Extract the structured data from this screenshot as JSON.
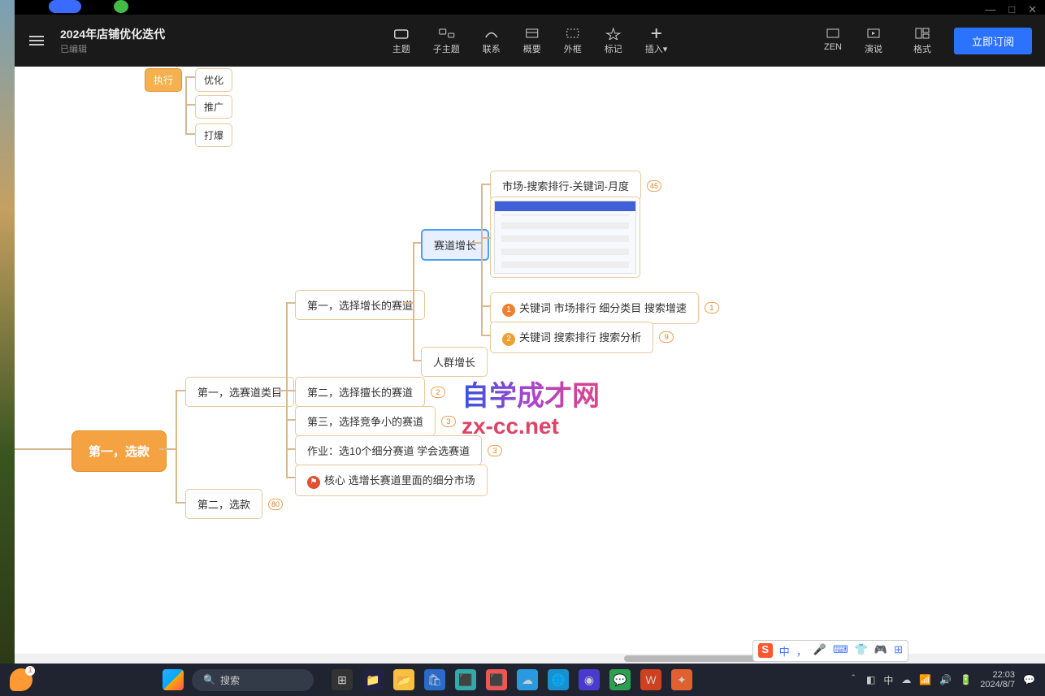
{
  "app": {
    "title": "2024年店铺优化迭代",
    "status": "已编辑",
    "subscribe": "立即订阅"
  },
  "toolbar": {
    "topic": "主题",
    "subtopic": "子主题",
    "relation": "联系",
    "summary": "概要",
    "boundary": "外框",
    "marker": "标记",
    "insert": "插入",
    "zen": "ZEN",
    "present": "演说",
    "format": "格式"
  },
  "mindmap": {
    "root": "第一，选款",
    "top": {
      "a": "执行",
      "b": "优化",
      "c": "推广",
      "d": "打爆"
    },
    "b1": "第一，选赛道类目",
    "b2": "第二，选款",
    "b2_count": "80",
    "c1": "第一，选择增长的赛道",
    "c2": "第二，选择擅长的赛道",
    "c2_count": "2",
    "c3": "第三，选择竞争小的赛道",
    "c3_count": "3",
    "c4": "作业：选10个细分赛道 学会选赛道",
    "c4_count": "3",
    "c5": "核心 选增长赛道里面的细分市场",
    "d1": "赛道增长",
    "d2": "人群增长",
    "e1": "市场-搜索排行-关键词-月度",
    "e1_count": "45",
    "e3": "关键词 市场排行 细分类目 搜索增速",
    "e3_count": "1",
    "e4": "关键词 搜索排行 搜索分析",
    "e4_count": "9"
  },
  "watermark": {
    "line1": "自学成才网",
    "line2": "zx-cc.net"
  },
  "taskbar": {
    "search": "搜索",
    "time": "22:03",
    "date": "2024/8/7",
    "ime_lang": "中"
  },
  "ime_float": [
    "中",
    "，",
    "",
    "",
    "",
    "",
    ""
  ]
}
